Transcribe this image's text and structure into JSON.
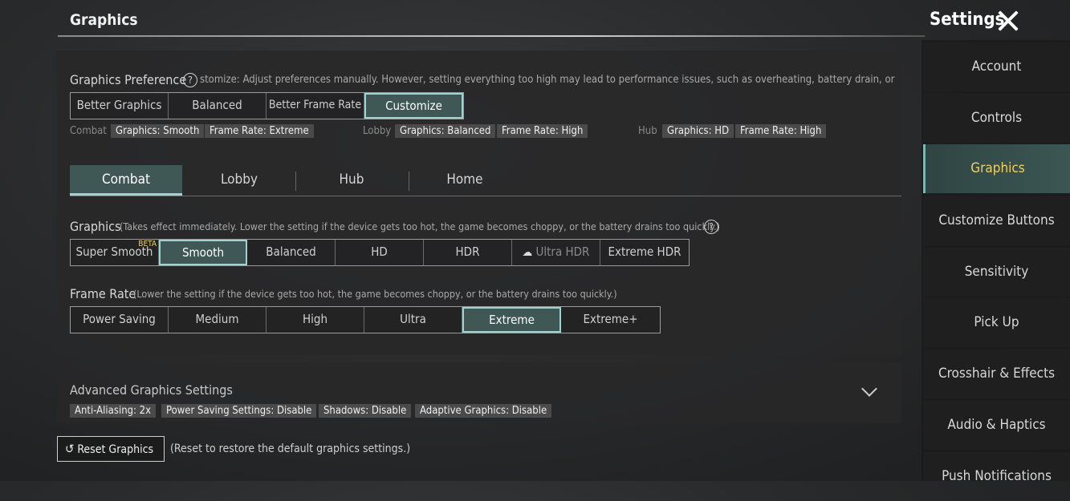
{
  "header": {
    "title": "Graphics",
    "settings_title": "Settings"
  },
  "preference": {
    "label": "Graphics Preference",
    "help": "?",
    "description": "stomize: Adjust preferences manually. However, setting everything too high may lead to performance issues, such as overheating, battery drain, or chop|",
    "options": [
      "Better Graphics",
      "Balanced",
      "Better Frame Rate",
      "Customize"
    ],
    "selected": "Customize",
    "summary": {
      "combat_label": "Combat",
      "combat_graphics": "Graphics: Smooth",
      "combat_framerate": "Frame Rate: Extreme",
      "lobby_label": "Lobby",
      "lobby_graphics": "Graphics: Balanced",
      "lobby_framerate": "Frame Rate: High",
      "hub_label": "Hub",
      "hub_graphics": "Graphics: HD",
      "hub_framerate": "Frame Rate: High"
    }
  },
  "tabs": [
    "Combat",
    "Lobby",
    "Hub",
    "Home"
  ],
  "active_tab": "Combat",
  "graphics": {
    "label": "Graphics",
    "note": "(Takes effect immediately. Lower the setting if the device gets too hot, the game becomes choppy, or the battery drains too quickly.)",
    "help": "?",
    "options": [
      "Super Smooth",
      "Smooth",
      "Balanced",
      "HD",
      "HDR",
      "Ultra HDR",
      "Extreme HDR"
    ],
    "beta_badge": "BETA",
    "selected": "Smooth"
  },
  "frame_rate": {
    "label": "Frame Rate",
    "note": "(Lower the setting if the device gets too hot, the game becomes choppy, or the battery drains too quickly.)",
    "options": [
      "Power Saving",
      "Medium",
      "High",
      "Ultra",
      "Extreme",
      "Extreme+"
    ],
    "selected": "Extreme"
  },
  "advanced": {
    "label": "Advanced Graphics Settings",
    "chips": [
      "Anti-Aliasing: 2x",
      "Power Saving Settings: Disable",
      "Shadows: Disable",
      "Adaptive Graphics: Disable"
    ]
  },
  "reset": {
    "label": "Reset Graphics",
    "note": "(Reset to restore the default graphics settings.)"
  },
  "sidebar": {
    "items": [
      "Account",
      "Controls",
      "Graphics",
      "Customize Buttons",
      "Sensitivity",
      "Pick Up",
      "Crosshair & Effects",
      "Audio & Haptics",
      "Push Notifications"
    ],
    "active": "Graphics"
  },
  "colors": {
    "accent": "#9fd3cf",
    "selected_bg": "#3f5856",
    "active_sidebar_text": "#f0d060"
  }
}
